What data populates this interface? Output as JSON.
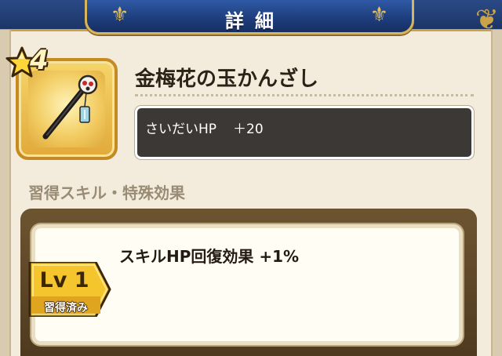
{
  "header": {
    "title": "詳細"
  },
  "item": {
    "name": "金梅花の玉かんざし",
    "icon": "hairpin-icon",
    "rarity": 4,
    "rarity_icon": "star-icon",
    "stat": {
      "label": "さいだいHP",
      "value": "＋20"
    }
  },
  "skills": {
    "heading": "習得スキル・特殊効果",
    "items": [
      {
        "text": "スキルHP回復効果 +1%",
        "level": "Lv 1",
        "status": "習得済み"
      }
    ]
  },
  "colors": {
    "header_blue": "#1d3c7a",
    "gold": "#d8b55a",
    "background": "#f3ecdd",
    "stat_box": "#3b3836",
    "level_badge": "#f5c52e"
  }
}
